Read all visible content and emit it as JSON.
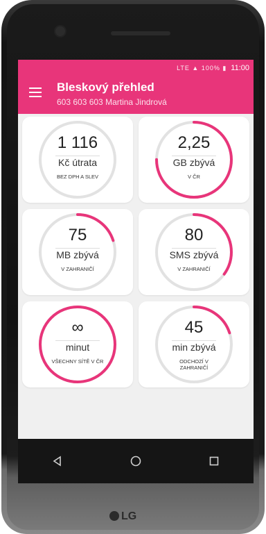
{
  "status": {
    "time": "11:00",
    "icons": "LTE ▲ 100% ▮"
  },
  "header": {
    "title": "Bleskový přehled",
    "subtitle": "603 603 603 Martina Jindrová"
  },
  "accent": "#e8357a",
  "tiles": [
    {
      "value": "1 116",
      "unit": "Kč útrata",
      "note": "BEZ DPH A SLEV",
      "fill": 0.0
    },
    {
      "value": "2,25",
      "unit": "GB zbývá",
      "note": "V ČR",
      "fill": 0.75
    },
    {
      "value": "75",
      "unit": "MB zbývá",
      "note": "V ZAHRANIČÍ",
      "fill": 0.2
    },
    {
      "value": "80",
      "unit": "SMS zbývá",
      "note": "V ZAHRANIČÍ",
      "fill": 0.35
    },
    {
      "value": "∞",
      "unit": "minut",
      "note": "VŠECHNY SÍTĚ V ČR",
      "fill": 1.0
    },
    {
      "value": "45",
      "unit": "min zbývá",
      "note": "ODCHOZÍ V ZAHRANIČÍ",
      "fill": 0.2
    }
  ],
  "nav": {
    "back": "◁",
    "home": "○",
    "recents": "□"
  },
  "brand": {
    "logo": "LG"
  }
}
